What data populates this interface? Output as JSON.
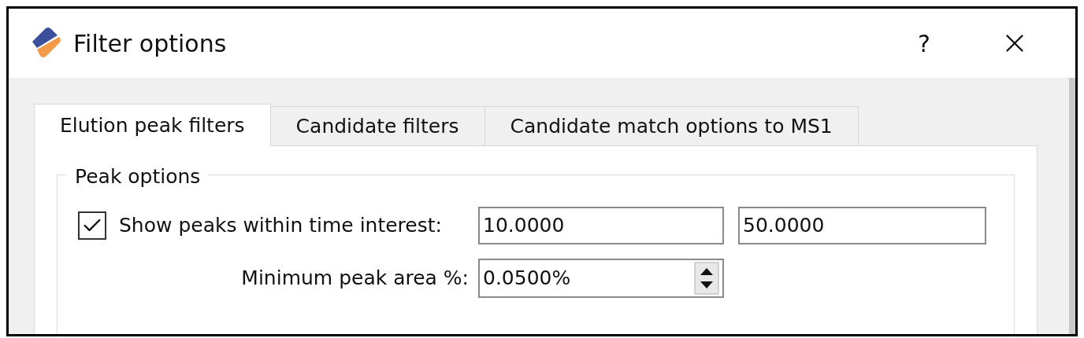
{
  "window": {
    "title": "Filter options",
    "help": "?"
  },
  "tabs": [
    {
      "label": "Elution peak filters",
      "selected": true
    },
    {
      "label": "Candidate filters",
      "selected": false
    },
    {
      "label": "Candidate match options to MS1",
      "selected": false
    }
  ],
  "group": {
    "title": "Peak options",
    "time_interest": {
      "label": "Show peaks within time interest:",
      "checked": true,
      "from": "10.0000",
      "to": "50.0000"
    },
    "min_area": {
      "label": "Minimum peak area %:",
      "value": "0.0500%"
    }
  }
}
